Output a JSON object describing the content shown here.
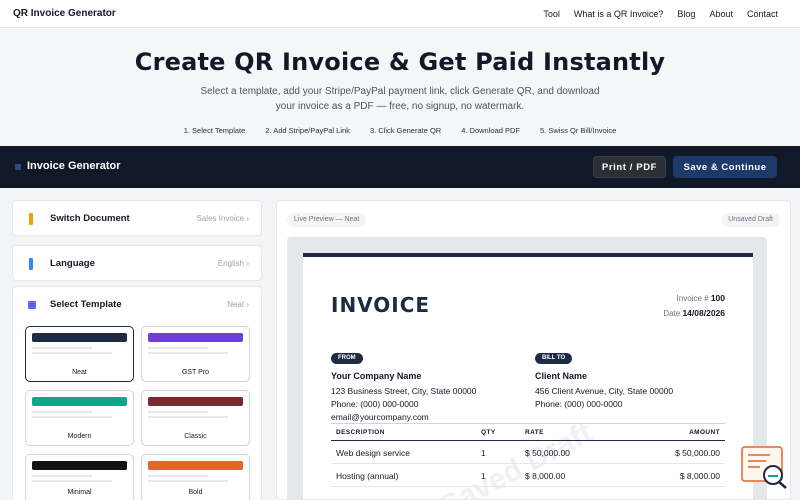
{
  "nav": {
    "brand": "QR Invoice Generator",
    "links": [
      "Tool",
      "What is a QR Invoice?",
      "Blog",
      "About",
      "Contact"
    ]
  },
  "hero": {
    "title": "Create QR Invoice & Get Paid Instantly",
    "subtitle": "Select a template, add your Stripe/PayPal payment link, click Generate QR, and download your invoice as a PDF — free, no signup, no watermark.",
    "steps": [
      "1. Select Template",
      "2. Add Stripe/PayPal Link",
      "3. Click Generate QR",
      "4. Download PDF",
      "5. Swiss Qr Bill/Invoice"
    ]
  },
  "toolbar": {
    "title": "Invoice Generator",
    "print_label": "Print / PDF",
    "save_label": "Save & Continue"
  },
  "sidebar": {
    "rows": [
      {
        "label": "Switch Document",
        "value": "Sales Invoice",
        "color": "#f59e0b"
      },
      {
        "label": "Language",
        "value": "English",
        "color": "#3b82f6"
      },
      {
        "label": "Select Template",
        "value": "Neat",
        "color": "#6366f1"
      }
    ],
    "chevron": "›",
    "templates": [
      {
        "name": "Neat",
        "color": "#1f2a44",
        "selected": true
      },
      {
        "name": "GST Pro",
        "color": "#6d3fd6"
      },
      {
        "name": "Modern",
        "color": "#14a38b"
      },
      {
        "name": "Classic",
        "color": "#7a2a2a"
      },
      {
        "name": "Minimal",
        "color": "#111111"
      },
      {
        "name": "Bold",
        "color": "#e0662a"
      }
    ]
  },
  "preview": {
    "live_label": "Live Preview — Neat",
    "status": "Unsaved Draft",
    "watermark": "Saved Draft",
    "invoice": {
      "title": "INVOICE",
      "number_label": "Invoice #",
      "number": "100",
      "date_label": "Date",
      "date": "14/08/2026",
      "from_tag": "FROM",
      "from": {
        "name": "Your Company Name",
        "address": "123 Business Street, City, State 00000",
        "phone": "Phone: (000) 000-0000",
        "email": "email@yourcompany.com"
      },
      "to_tag": "BILL TO",
      "to": {
        "name": "Client Name",
        "address": "456 Client Avenue, City, State 00000",
        "phone": "Phone: (000) 000-0000"
      },
      "columns": [
        "DESCRIPTION",
        "QTY",
        "RATE",
        "AMOUNT"
      ],
      "rows": [
        {
          "desc": "Web design service",
          "qty": "1",
          "rate": "$ 50,000.00",
          "amount": "$ 50,000.00"
        },
        {
          "desc": "Hosting (annual)",
          "qty": "1",
          "rate": "$ 8,000.00",
          "amount": "$ 8,000.00"
        }
      ]
    }
  },
  "widget": {
    "icon": "search-document-icon"
  }
}
